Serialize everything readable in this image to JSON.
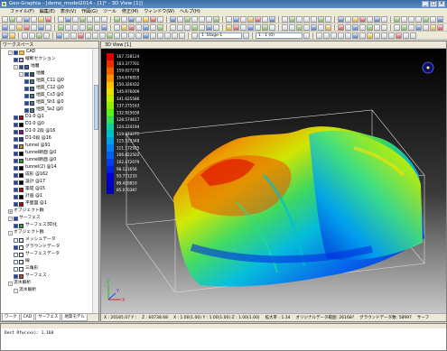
{
  "window": {
    "title": "Geo-Graphia - [demo_model2014 - [1]* - 3D View [1]]",
    "controls": [
      "_",
      "□",
      "×"
    ]
  },
  "menu": [
    "ファイル(F)",
    "編集(E)",
    "表示(V)",
    "作図(G)",
    "ツール",
    "修正(M)",
    "ウィンドウ(W)",
    "ヘルプ(H)"
  ],
  "toolbar": {
    "stage_label": "1 :Stage-1",
    "page_label": "1 : 1 (0)"
  },
  "workspace": {
    "title": "ワークスペース"
  },
  "tree": [
    {
      "label": "CAD",
      "indent": 1,
      "exp": "-",
      "cb": true,
      "fold": true
    },
    {
      "label": "縦断セクション",
      "indent": 2,
      "cb": true,
      "sw": "#b0b0ff"
    },
    {
      "label": "地層",
      "indent": 2,
      "exp": "-",
      "cb": true,
      "sw": "#4060c0"
    },
    {
      "label": "地層",
      "indent": 3,
      "exp": "-",
      "cb": true,
      "sw": "#3050b0"
    },
    {
      "label": "地質_C11 @0",
      "indent": 4,
      "cb": true,
      "sw": "#4a78d8"
    },
    {
      "label": "地質_C12 @0",
      "indent": 4,
      "cb": true,
      "sw": "#4a78d8"
    },
    {
      "label": "地質_Cs3 @0",
      "indent": 4,
      "cb": true,
      "sw": "#4a78d8"
    },
    {
      "label": "地質_Sh1 @0",
      "indent": 4,
      "cb": true,
      "sw": "#4a78d8"
    },
    {
      "label": "地質_Ss2 @0",
      "indent": 4,
      "cb": true,
      "sw": "#4a78d8"
    },
    {
      "label": "D1-0 @1",
      "indent": 2,
      "cb": true,
      "sw": "#c00000"
    },
    {
      "label": "D1-0 @0",
      "indent": 2,
      "cb": true,
      "sw": "#000000"
    },
    {
      "label": "D1-0 2段 @16",
      "indent": 2,
      "cb": true,
      "sw": "#a000a0"
    },
    {
      "label": "D1-0段 @16",
      "indent": 2,
      "cb": true,
      "sw": "#2040c0"
    },
    {
      "label": "tunnel @91",
      "indent": 2,
      "cb": true,
      "sw": "#c0a000"
    },
    {
      "label": "tunnel断面 @0",
      "indent": 2,
      "cb": true,
      "sw": "#000000"
    },
    {
      "label": "tunnel断面 @0",
      "indent": 2,
      "cb": true,
      "sw": "#20a020"
    },
    {
      "label": "tunnel(2) @14",
      "indent": 2,
      "cb": true,
      "sw": "#000000"
    },
    {
      "label": "成形 @162",
      "indent": 2,
      "cb": true,
      "sw": "#000000"
    },
    {
      "label": "設計 @17",
      "indent": 2,
      "cb": true,
      "sw": "#000000"
    },
    {
      "label": "築堤 @15",
      "indent": 2,
      "cb": true,
      "sw": "#c00000"
    },
    {
      "label": "計画 @1",
      "indent": 2,
      "cb": true,
      "sw": "#000000"
    },
    {
      "label": "平面図 @1",
      "indent": 2,
      "cb": true,
      "sw": "#c00000"
    },
    {
      "label": "オブジェクト群",
      "indent": 1,
      "exp": "+"
    },
    {
      "label": "サーフェス",
      "indent": 1,
      "exp": "-",
      "cb": true
    },
    {
      "label": "サーフェス3D化",
      "indent": 2,
      "cb": true,
      "sw": "#40a040"
    },
    {
      "label": "オブジェクト群",
      "indent": 1,
      "exp": "-"
    },
    {
      "label": "メッシュデータ",
      "indent": 2,
      "cb": false,
      "sw": "#e0e0ff"
    },
    {
      "label": "グラウンドデータ",
      "indent": 2,
      "cb": true,
      "sw": "#ffffff"
    },
    {
      "label": "サーフェスデータ",
      "indent": 2,
      "cb": false,
      "sw": "#ffffff"
    },
    {
      "label": "線",
      "indent": 2,
      "cb": false,
      "sw": "#ffffff"
    },
    {
      "label": "三角形",
      "indent": 2,
      "cb": false,
      "sw": "#ffffff"
    },
    {
      "label": "サーフェス",
      "indent": 2,
      "cb": true,
      "sw": "#c04040"
    },
    {
      "label": "流水解析",
      "indent": 1,
      "exp": "-"
    },
    {
      "label": "流水解析",
      "indent": 2,
      "exp": "-"
    }
  ],
  "left_tabs": [
    "ワーク",
    "CAD",
    "サーフェス",
    "地質モデル"
  ],
  "view": {
    "tab": "3D View [1]"
  },
  "legend": {
    "values": [
      "167.728124",
      "163.377701",
      "159.027278",
      "154.676855",
      "150.326432",
      "145.976009",
      "141.625586",
      "137.275163",
      "132.925039",
      "128.574617",
      "124.224194",
      "119.873771",
      "115.523348",
      "111.172925",
      "106.822502",
      "102.472079",
      "98.121656",
      "93.771233",
      "89.420810",
      "85.070387"
    ],
    "colors": [
      "#e00000",
      "#e83000",
      "#f06000",
      "#f89000",
      "#ffc000",
      "#e8e000",
      "#c0f000",
      "#90f000",
      "#60f020",
      "#30e060",
      "#10d0a0",
      "#00c0d0",
      "#00a0e8",
      "#0080f0",
      "#0060f0",
      "#0040f0",
      "#0020e0",
      "#0000d0",
      "#0000c0",
      "#0000b0"
    ]
  },
  "axis_labels": {
    "x": "X",
    "y": "Y",
    "z": "Z"
  },
  "status": [
    "X : 20185.07 Y :",
    "Z : 60738.68",
    "X : 1.00(1.00) Y : 1.00(1.00) Z : 1.00(1.00)",
    "拡大率 : 1.34",
    "オリジナルデータ範囲: 26168?",
    "グラウンドデータ数: 58997",
    "サーフ"
  ],
  "output": {
    "text": "Dest Rfw(xxx): 1.168"
  }
}
